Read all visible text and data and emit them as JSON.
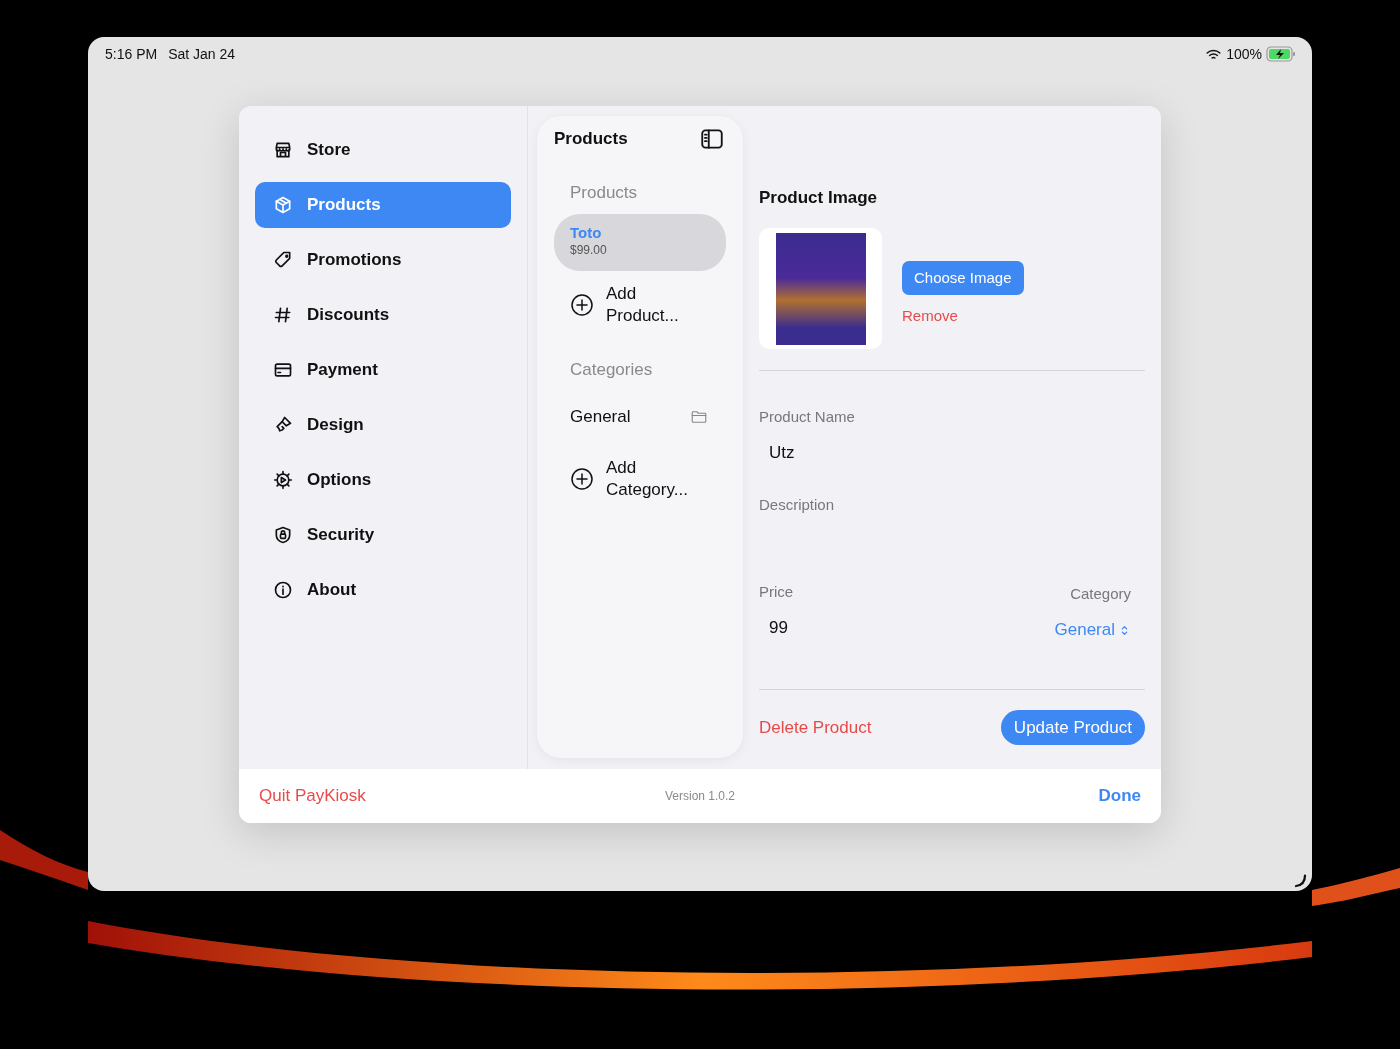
{
  "status_bar": {
    "time": "5:16 PM",
    "date": "Sat Jan 24",
    "battery": "100%"
  },
  "sidebar": {
    "items": [
      {
        "label": "Store",
        "selected": false
      },
      {
        "label": "Products",
        "selected": true
      },
      {
        "label": "Promotions",
        "selected": false
      },
      {
        "label": "Discounts",
        "selected": false
      },
      {
        "label": "Payment",
        "selected": false
      },
      {
        "label": "Design",
        "selected": false
      },
      {
        "label": "Options",
        "selected": false
      },
      {
        "label": "Security",
        "selected": false
      },
      {
        "label": "About",
        "selected": false
      }
    ]
  },
  "list_panel": {
    "title": "Products",
    "sections": [
      {
        "header": "Products",
        "rows": [
          {
            "kind": "item",
            "title": "Toto",
            "subtitle": "$99.00",
            "selected": true
          },
          {
            "kind": "add",
            "label": "Add Product..."
          }
        ]
      },
      {
        "header": "Categories",
        "rows": [
          {
            "kind": "category",
            "label": "General"
          },
          {
            "kind": "add",
            "label": "Add Category..."
          }
        ]
      }
    ]
  },
  "detail": {
    "image_title": "Product Image",
    "choose_button": "Choose Image",
    "remove_button": "Remove",
    "name_label": "Product Name",
    "name_value": "Utz",
    "description_label": "Description",
    "price_label": "Price",
    "price_value": "99",
    "category_label": "Category",
    "category_value": "General",
    "delete_button": "Delete Product",
    "update_button": "Update Product"
  },
  "footer": {
    "quit": "Quit PayKiosk",
    "version": "Version 1.0.2",
    "done": "Done"
  }
}
